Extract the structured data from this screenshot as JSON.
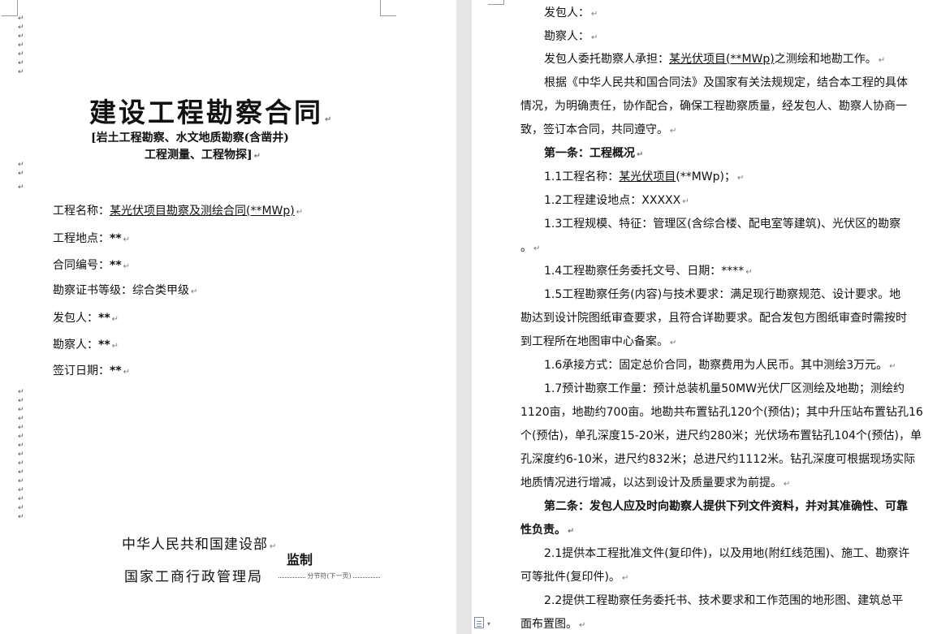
{
  "paragraph_mark": "↵",
  "left_page": {
    "title": "建设工程勘察合同",
    "subtitle_line1": "[岩土工程勘察、水文地质勘察(含凿井)",
    "subtitle_line2": "工程测量、工程物探]",
    "fields": [
      {
        "label": "工程名称：",
        "value": "某光伏项目勘察及测绘合同(**MWp)"
      },
      {
        "label": "工程地点：",
        "value": "**"
      },
      {
        "label": "合同编号：",
        "value": "**"
      },
      {
        "label": "勘察证书等级：",
        "value": "综合类甲级"
      },
      {
        "label": "发包人：",
        "value": "**"
      },
      {
        "label": "勘察人：",
        "value": "**"
      },
      {
        "label": "签订日期：",
        "value": "**"
      }
    ],
    "footer_line1": "中华人民共和国建设部",
    "footer_line2": "国家工商行政管理局",
    "supervise": "监制",
    "section_break": "分节符(下一页)"
  },
  "right_page": {
    "lines": [
      "发包人：",
      "勘察人：",
      "发包人委托勘察人承担：",
      "某光伏项目(**MWp)",
      "之测绘和地勘工作。",
      "根据《中华人民共和国合同法》及国家有关法规规定，结合本工程的具体",
      "情况，为明确责任，协作配合，确保工程勘察质量，经发包人、勘察人协商一",
      "致，签订本合同，共同遵守。",
      "第一条：工程概况",
      "1.1工程名称：",
      "某光伏项目",
      "(**MWp)；",
      "1.2工程建设地点：XXXXX",
      "1.3工程规模、特征：管理区(含综合楼、配电室等建筑)、光伏区的勘察",
      "。",
      "1.4工程勘察任务委托文号、日期：****",
      "1.5工程勘察任务(内容)与技术要求：满足现行勘察规范、设计要求。地",
      "勘达到设计院图纸审查要求，且符合详勘要求。配合发包方图纸审查时需按时",
      "到工程所在地图审中心备案。",
      "1.6承接方式：固定总价合同，勘察费用为人民币。其中测绘3万元。",
      "1.7预计勘察工作量：预计总装机量50MW光伏厂区测绘及地勘；测绘约",
      "1120亩，地勘约700亩。地勘共布置钻孔120个(预估)；其中升压站布置钻孔16",
      "个(预估)，单孔深度15-20米，进尺约280米；光伏场布置钻孔104个(预估)，单",
      "孔深度约6-10米，进尺约832米；总进尺约1112米。钻孔深度可根据现场实际",
      "地质情况进行增减，以达到设计及质量要求为前提。",
      "第二条：发包人应及时向勘察人提供下列文件资料，并对其准确性、可靠",
      "性负责。",
      "2.1提供本工程批准文件(复印件)，以及用地(附红线范围)、施工、勘察许",
      "可等批件(复印件)。",
      "2.2提供工程勘察任务委托书、技术要求和工作范围的地形图、建筑总平",
      "面布置图。"
    ]
  }
}
